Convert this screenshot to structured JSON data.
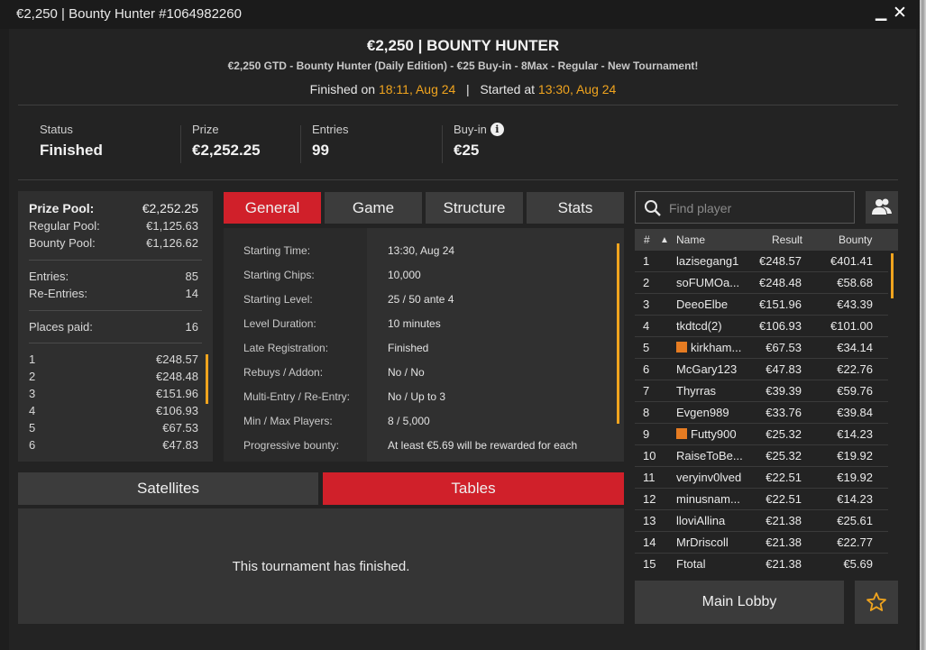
{
  "window": {
    "title": "€2,250  |  Bounty Hunter #1064982260",
    "minimize": "▁",
    "close": "✕"
  },
  "header": {
    "title": "€2,250  |  BOUNTY HUNTER",
    "subtitle": "€2,250 GTD - Bounty Hunter (Daily Edition) - €25 Buy-in - 8Max - Regular - New Tournament!",
    "finished_label": "Finished on",
    "finished_time": "18:11, Aug 24",
    "divider": "|",
    "started_label": "Started at",
    "started_time": "13:30, Aug 24"
  },
  "summary": {
    "status_label": "Status",
    "status_value": "Finished",
    "prize_label": "Prize",
    "prize_value": "€2,252.25",
    "entries_label": "Entries",
    "entries_value": "99",
    "buyin_label": "Buy-in",
    "buyin_value": "€25",
    "info_icon": "i"
  },
  "prize_pool": {
    "prize_pool_label": "Prize Pool:",
    "prize_pool_value": "€2,252.25",
    "regular_pool_label": "Regular Pool:",
    "regular_pool_value": "€1,125.63",
    "bounty_pool_label": "Bounty Pool:",
    "bounty_pool_value": "€1,126.62",
    "entries_label": "Entries:",
    "entries_value": "85",
    "reentries_label": "Re-Entries:",
    "reentries_value": "14",
    "places_label": "Places paid:",
    "places_value": "16",
    "payouts": [
      {
        "place": "1",
        "amount": "€248.57"
      },
      {
        "place": "2",
        "amount": "€248.48"
      },
      {
        "place": "3",
        "amount": "€151.96"
      },
      {
        "place": "4",
        "amount": "€106.93"
      },
      {
        "place": "5",
        "amount": "€67.53"
      },
      {
        "place": "6",
        "amount": "€47.83"
      }
    ]
  },
  "tabs": [
    {
      "label": "General"
    },
    {
      "label": "Game"
    },
    {
      "label": "Structure"
    },
    {
      "label": "Stats"
    }
  ],
  "general": [
    {
      "label": "Starting Time:",
      "value": "13:30, Aug 24"
    },
    {
      "label": "Starting Chips:",
      "value": "10,000"
    },
    {
      "label": "Starting Level:",
      "value": "25 / 50 ante 4"
    },
    {
      "label": "Level Duration:",
      "value": "10 minutes"
    },
    {
      "label": "Late Registration:",
      "value": "Finished"
    },
    {
      "label": "Rebuys / Addon:",
      "value": "No / No"
    },
    {
      "label": "Multi-Entry / Re-Entry:",
      "value": "No / Up to 3"
    },
    {
      "label": "Min / Max Players:",
      "value": "8 / 5,000"
    },
    {
      "label": "Progressive bounty:",
      "value": "At least €5.69 will be rewarded for each"
    }
  ],
  "bottom_tabs": {
    "satellites": "Satellites",
    "tables": "Tables"
  },
  "finished_message": "This tournament has finished.",
  "search": {
    "placeholder": "Find player"
  },
  "leaderboard": {
    "headers": {
      "rank": "#",
      "sort": "▲",
      "name": "Name",
      "result": "Result",
      "bounty": "Bounty"
    },
    "rows": [
      {
        "rank": "1",
        "name": "lazisegang1",
        "result": "€248.57",
        "bounty": "€401.41"
      },
      {
        "rank": "2",
        "name": "soFUMOa...",
        "result": "€248.48",
        "bounty": "€58.68"
      },
      {
        "rank": "3",
        "name": "DeeoElbe",
        "result": "€151.96",
        "bounty": "€43.39"
      },
      {
        "rank": "4",
        "name": "tkdtcd(2)",
        "result": "€106.93",
        "bounty": "€101.00"
      },
      {
        "rank": "5",
        "name": "kirkham...",
        "result": "€67.53",
        "bounty": "€34.14"
      },
      {
        "rank": "6",
        "name": "McGary123",
        "result": "€47.83",
        "bounty": "€22.76"
      },
      {
        "rank": "7",
        "name": "Thyrras",
        "result": "€39.39",
        "bounty": "€59.76"
      },
      {
        "rank": "8",
        "name": "Evgen989",
        "result": "€33.76",
        "bounty": "€39.84"
      },
      {
        "rank": "9",
        "name": "Futty900",
        "result": "€25.32",
        "bounty": "€14.23"
      },
      {
        "rank": "10",
        "name": "RaiseToBe...",
        "result": "€25.32",
        "bounty": "€19.92"
      },
      {
        "rank": "11",
        "name": "veryinv0lved",
        "result": "€22.51",
        "bounty": "€19.92"
      },
      {
        "rank": "12",
        "name": "minusnam...",
        "result": "€22.51",
        "bounty": "€14.23"
      },
      {
        "rank": "13",
        "name": "lloviAllina",
        "result": "€21.38",
        "bounty": "€25.61"
      },
      {
        "rank": "14",
        "name": "MrDriscoll",
        "result": "€21.38",
        "bounty": "€22.77"
      },
      {
        "rank": "15",
        "name": "Ftotal",
        "result": "€21.38",
        "bounty": "€5.69"
      }
    ]
  },
  "footer": {
    "main_lobby": "Main Lobby"
  },
  "colors": {
    "accent_red": "#d0202a",
    "highlight_orange": "#f0a41e",
    "flag_orange": "#e67c22"
  }
}
